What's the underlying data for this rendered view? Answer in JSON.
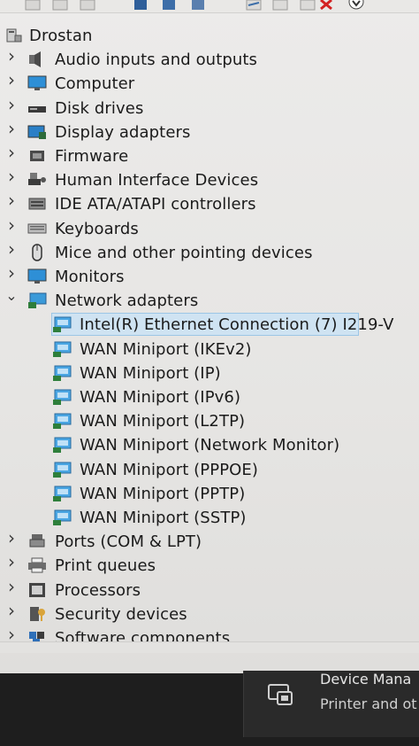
{
  "root": {
    "label": "Drostan",
    "icon": "computer-tower-icon"
  },
  "categories": [
    {
      "label": "Audio inputs and outputs",
      "icon": "speaker-icon",
      "expanded": false
    },
    {
      "label": "Computer",
      "icon": "monitor-icon",
      "expanded": false
    },
    {
      "label": "Disk drives",
      "icon": "disk-drive-icon",
      "expanded": false
    },
    {
      "label": "Display adapters",
      "icon": "display-adapter-icon",
      "expanded": false
    },
    {
      "label": "Firmware",
      "icon": "firmware-chip-icon",
      "expanded": false
    },
    {
      "label": "Human Interface Devices",
      "icon": "hid-icon",
      "expanded": false
    },
    {
      "label": "IDE ATA/ATAPI controllers",
      "icon": "ide-controller-icon",
      "expanded": false
    },
    {
      "label": "Keyboards",
      "icon": "keyboard-icon",
      "expanded": false
    },
    {
      "label": "Mice and other pointing devices",
      "icon": "mouse-icon",
      "expanded": false
    },
    {
      "label": "Monitors",
      "icon": "monitor-icon",
      "expanded": false
    },
    {
      "label": "Network adapters",
      "icon": "network-adapter-icon",
      "expanded": true
    }
  ],
  "network_adapters": [
    {
      "label": "Intel(R) Ethernet Connection (7) I219-V",
      "selected": true
    },
    {
      "label": "WAN Miniport (IKEv2)"
    },
    {
      "label": "WAN Miniport (IP)"
    },
    {
      "label": "WAN Miniport (IPv6)"
    },
    {
      "label": "WAN Miniport (L2TP)"
    },
    {
      "label": "WAN Miniport (Network Monitor)"
    },
    {
      "label": "WAN Miniport (PPPOE)"
    },
    {
      "label": "WAN Miniport (PPTP)"
    },
    {
      "label": "WAN Miniport (SSTP)"
    }
  ],
  "after_categories": [
    {
      "label": "Ports (COM & LPT)",
      "icon": "port-icon"
    },
    {
      "label": "Print queues",
      "icon": "printer-icon"
    },
    {
      "label": "Processors",
      "icon": "processor-icon"
    },
    {
      "label": "Security devices",
      "icon": "security-key-icon"
    },
    {
      "label": "Software components",
      "icon": "software-component-icon"
    }
  ],
  "toast": {
    "title": "Device Mana",
    "subtitle": "Printer and ot"
  },
  "colors": {
    "selection_bg": "#cfe3f2",
    "selection_border": "#9cc6e6",
    "taskbar": "#1e1e1e"
  }
}
